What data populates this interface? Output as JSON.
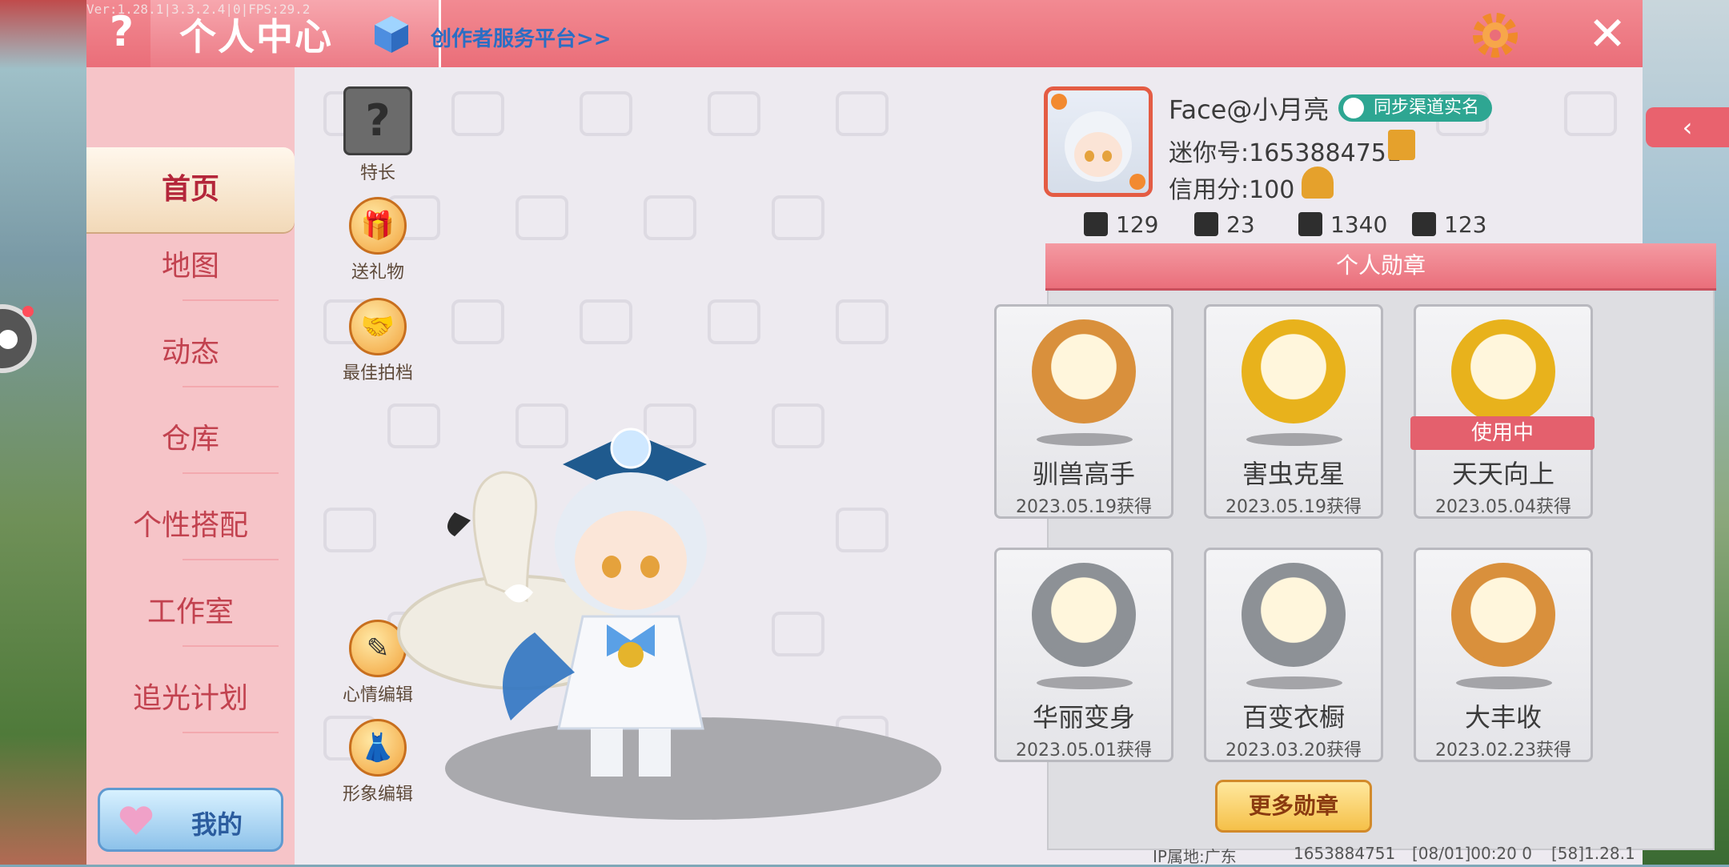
{
  "debug_text": "Ver:1.28.1|3.3.2.4|0|FPS:29.2",
  "header": {
    "help": "?",
    "title": "个人中心",
    "creator_link": "创作者服务平台>>",
    "close": "✕"
  },
  "right_tab_arrow": "‹",
  "sidebar": {
    "items": [
      {
        "label": "首页",
        "active": true
      },
      {
        "label": "地图"
      },
      {
        "label": "动态"
      },
      {
        "label": "仓库"
      },
      {
        "label": "个性搭配"
      },
      {
        "label": "工作室"
      },
      {
        "label": "追光计划"
      }
    ],
    "mine_button": "我的"
  },
  "side_actions": {
    "specialty": "特长",
    "specialty_icon": "?",
    "gift": "送礼物",
    "partner": "最佳拍档",
    "mood_edit": "心情编辑",
    "image_edit": "形象编辑"
  },
  "profile": {
    "name": "Face@小月亮",
    "realname_badge": "同步渠道实名",
    "mini_id": "迷你号:1653884751",
    "credit": "信用分:100",
    "stats": [
      "129",
      "23",
      "1340",
      "123"
    ]
  },
  "medals": {
    "title": "个人勋章",
    "in_use": "使用中",
    "items": [
      {
        "name": "驯兽高手",
        "date": "2023.05.19获得",
        "color": "#d9903c"
      },
      {
        "name": "害虫克星",
        "date": "2023.05.19获得",
        "color": "#e8b21c"
      },
      {
        "name": "天天向上",
        "date": "2023.05.04获得",
        "color": "#e8b21c"
      },
      {
        "name": "华丽变身",
        "date": "2023.05.01获得",
        "color": "#8d9196"
      },
      {
        "name": "百变衣橱",
        "date": "2023.03.20获得",
        "color": "#8d9196"
      },
      {
        "name": "大丰收",
        "date": "2023.02.23获得",
        "color": "#d9903c"
      }
    ],
    "more_button": "更多勋章"
  },
  "footer": {
    "ip": "IP属地:广东",
    "uid": "1653884751",
    "time": "[08/01]00:20 0",
    "version": "[58]1.28.1"
  }
}
